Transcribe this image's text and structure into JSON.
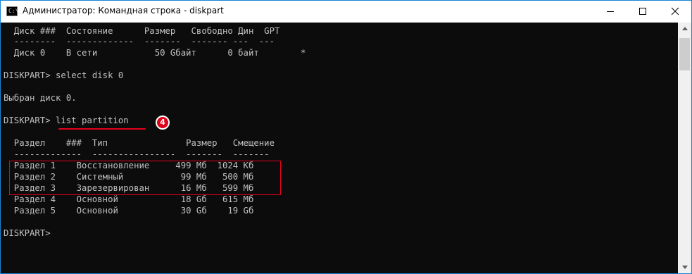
{
  "window": {
    "title": "Администратор: Командная строка - diskpart",
    "app_icon_text": "C:\\_",
    "controls": {
      "minimize": "minimize",
      "maximize": "maximize",
      "close": "close"
    }
  },
  "console": {
    "lines": [
      "  Диск ###  Состояние      Размер   Свободно Дин  GPT",
      "  --------  -------------  -------  ------- ---  ---",
      "  Диск 0    В сети           50 Gбайт      0 байт        *",
      "",
      "DISKPART> select disk 0",
      "",
      "Выбран диск 0.",
      "",
      "DISKPART> list partition",
      "",
      "  Раздел    ###  Тип               Размер   Смещение",
      "  -------------  ----------------  -------  -------",
      "  Раздел 1    Восстановление     499 Мб  1024 Кб",
      "  Раздел 2    Системный           99 Мб   500 Мб",
      "  Раздел 3    Зарезервирован      16 Мб   599 Мб",
      "  Раздел 4    Основной            18 Gб   615 Мб",
      "  Раздел 5    Основной            30 Gб    19 Gб",
      "",
      "DISKPART>"
    ]
  },
  "annotations": {
    "step_badge": "4",
    "accent_color": "#e3001b"
  },
  "scrollbar": {
    "position_fraction": 0.0
  }
}
